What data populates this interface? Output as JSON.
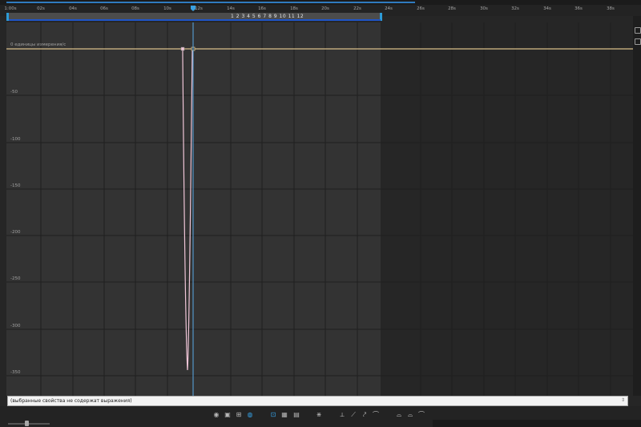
{
  "timeline": {
    "ticks": [
      "1:00s",
      "02s",
      "04s",
      "06s",
      "08s",
      "10s",
      "12s",
      "14s",
      "16s",
      "18s",
      "20s",
      "22s",
      "24s",
      "26s",
      "28s",
      "30s",
      "32s",
      "34s",
      "36s",
      "38s"
    ],
    "markers": "1 2 3 4 5 6 7 8 9 10 11 12"
  },
  "graph": {
    "unit_label": "0 единицы измерения/с",
    "y_labels": [
      "-50",
      "-100",
      "-150",
      "-200",
      "-250",
      "-300",
      "-350"
    ]
  },
  "expression": {
    "text": "(выбранные свойства не содержат выражения)"
  },
  "colors": {
    "accent": "#2d9bd6",
    "curve": "#f0c6d8",
    "baseline": "#d9c08a",
    "cti": "#5aa9e6"
  },
  "toolbar": {
    "icons": [
      "eye-icon",
      "graph-type-icon",
      "transform-box-icon",
      "snap-icon",
      "fit-selection-icon",
      "fit-all-icon",
      "graph-editor-icon",
      "separate-dimensions-icon",
      "hold-keyframe-icon",
      "linear-keyframe-icon",
      "auto-bezier-icon",
      "easy-ease-icon",
      "easy-ease-in-icon",
      "easy-ease-out-icon"
    ]
  }
}
